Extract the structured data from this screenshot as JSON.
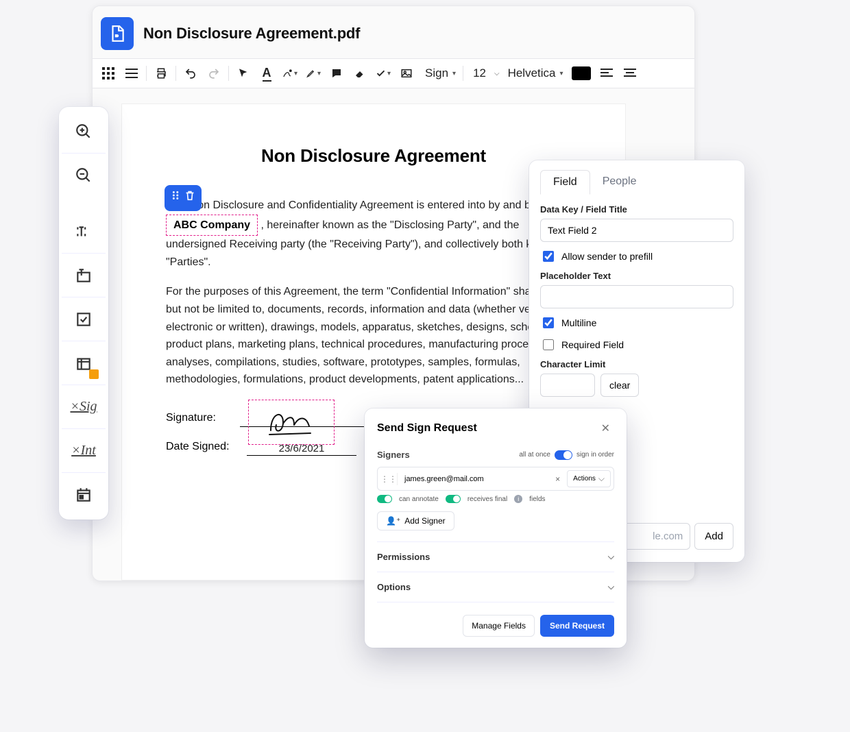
{
  "header": {
    "doc_title": "Non Disclosure Agreement.pdf"
  },
  "toolbar": {
    "sign_label": "Sign",
    "font_size": "12",
    "font_family": "Helvetica"
  },
  "document": {
    "heading": "Non Disclosure Agreement",
    "para1_a": "This Non Disclosure and Confidentiality Agreement is entered into by and between ",
    "field_company": "ABC Company",
    "para1_b": ", hereinafter known as the \"Disclosing Party\", and the undersigned Receiving party (the \"Receiving Party\"), and collectively both known as \"Parties\".",
    "para2": "For the purposes of this Agreement, the term \"Confidential Information\" shall include, but not be limited to, documents, records, information and data (whether verbal, electronic or written), drawings, models, apparatus, sketches, designs, schedules, product plans, marketing plans, technical procedures, manufacturing processes, analyses, compilations, studies, software, prototypes, samples, formulas, methodologies, formulations, product developments, patent applications...",
    "sig_label": "Signature:",
    "date_label": "Date Signed:",
    "date_value": "23/6/2021"
  },
  "prop_panel": {
    "tab_field": "Field",
    "tab_people": "People",
    "label_key": "Data Key / Field Title",
    "key_value": "Text Field 2",
    "allow_prefill": "Allow sender to prefill",
    "placeholder_label": "Placeholder Text",
    "multiline": "Multiline",
    "required": "Required Field",
    "charlimit_label": "Character Limit",
    "clear": "clear",
    "add_input_placeholder": "le.com",
    "add_btn": "Add"
  },
  "sign_modal": {
    "title": "Send Sign Request",
    "signers_label": "Signers",
    "all_at_once": "all at once",
    "sign_in_order": "sign in order",
    "signer_email": "james.green@mail.com",
    "actions": "Actions",
    "can_annotate": "can annotate",
    "receives_final": "receives final",
    "fields": "fields",
    "add_signer": "Add Signer",
    "permissions": "Permissions",
    "options": "Options",
    "manage_fields": "Manage Fields",
    "send_request": "Send Request"
  }
}
